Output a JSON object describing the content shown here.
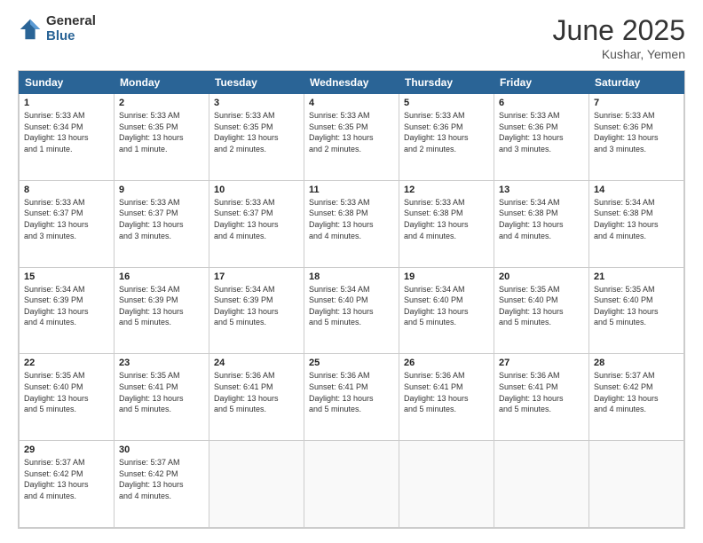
{
  "logo": {
    "general": "General",
    "blue": "Blue"
  },
  "title": "June 2025",
  "location": "Kushar, Yemen",
  "days_of_week": [
    "Sunday",
    "Monday",
    "Tuesday",
    "Wednesday",
    "Thursday",
    "Friday",
    "Saturday"
  ],
  "weeks": [
    [
      {
        "day": "1",
        "info": "Sunrise: 5:33 AM\nSunset: 6:34 PM\nDaylight: 13 hours\nand 1 minute."
      },
      {
        "day": "2",
        "info": "Sunrise: 5:33 AM\nSunset: 6:35 PM\nDaylight: 13 hours\nand 1 minute."
      },
      {
        "day": "3",
        "info": "Sunrise: 5:33 AM\nSunset: 6:35 PM\nDaylight: 13 hours\nand 2 minutes."
      },
      {
        "day": "4",
        "info": "Sunrise: 5:33 AM\nSunset: 6:35 PM\nDaylight: 13 hours\nand 2 minutes."
      },
      {
        "day": "5",
        "info": "Sunrise: 5:33 AM\nSunset: 6:36 PM\nDaylight: 13 hours\nand 2 minutes."
      },
      {
        "day": "6",
        "info": "Sunrise: 5:33 AM\nSunset: 6:36 PM\nDaylight: 13 hours\nand 3 minutes."
      },
      {
        "day": "7",
        "info": "Sunrise: 5:33 AM\nSunset: 6:36 PM\nDaylight: 13 hours\nand 3 minutes."
      }
    ],
    [
      {
        "day": "8",
        "info": "Sunrise: 5:33 AM\nSunset: 6:37 PM\nDaylight: 13 hours\nand 3 minutes."
      },
      {
        "day": "9",
        "info": "Sunrise: 5:33 AM\nSunset: 6:37 PM\nDaylight: 13 hours\nand 3 minutes."
      },
      {
        "day": "10",
        "info": "Sunrise: 5:33 AM\nSunset: 6:37 PM\nDaylight: 13 hours\nand 4 minutes."
      },
      {
        "day": "11",
        "info": "Sunrise: 5:33 AM\nSunset: 6:38 PM\nDaylight: 13 hours\nand 4 minutes."
      },
      {
        "day": "12",
        "info": "Sunrise: 5:33 AM\nSunset: 6:38 PM\nDaylight: 13 hours\nand 4 minutes."
      },
      {
        "day": "13",
        "info": "Sunrise: 5:34 AM\nSunset: 6:38 PM\nDaylight: 13 hours\nand 4 minutes."
      },
      {
        "day": "14",
        "info": "Sunrise: 5:34 AM\nSunset: 6:38 PM\nDaylight: 13 hours\nand 4 minutes."
      }
    ],
    [
      {
        "day": "15",
        "info": "Sunrise: 5:34 AM\nSunset: 6:39 PM\nDaylight: 13 hours\nand 4 minutes."
      },
      {
        "day": "16",
        "info": "Sunrise: 5:34 AM\nSunset: 6:39 PM\nDaylight: 13 hours\nand 5 minutes."
      },
      {
        "day": "17",
        "info": "Sunrise: 5:34 AM\nSunset: 6:39 PM\nDaylight: 13 hours\nand 5 minutes."
      },
      {
        "day": "18",
        "info": "Sunrise: 5:34 AM\nSunset: 6:40 PM\nDaylight: 13 hours\nand 5 minutes."
      },
      {
        "day": "19",
        "info": "Sunrise: 5:34 AM\nSunset: 6:40 PM\nDaylight: 13 hours\nand 5 minutes."
      },
      {
        "day": "20",
        "info": "Sunrise: 5:35 AM\nSunset: 6:40 PM\nDaylight: 13 hours\nand 5 minutes."
      },
      {
        "day": "21",
        "info": "Sunrise: 5:35 AM\nSunset: 6:40 PM\nDaylight: 13 hours\nand 5 minutes."
      }
    ],
    [
      {
        "day": "22",
        "info": "Sunrise: 5:35 AM\nSunset: 6:40 PM\nDaylight: 13 hours\nand 5 minutes."
      },
      {
        "day": "23",
        "info": "Sunrise: 5:35 AM\nSunset: 6:41 PM\nDaylight: 13 hours\nand 5 minutes."
      },
      {
        "day": "24",
        "info": "Sunrise: 5:36 AM\nSunset: 6:41 PM\nDaylight: 13 hours\nand 5 minutes."
      },
      {
        "day": "25",
        "info": "Sunrise: 5:36 AM\nSunset: 6:41 PM\nDaylight: 13 hours\nand 5 minutes."
      },
      {
        "day": "26",
        "info": "Sunrise: 5:36 AM\nSunset: 6:41 PM\nDaylight: 13 hours\nand 5 minutes."
      },
      {
        "day": "27",
        "info": "Sunrise: 5:36 AM\nSunset: 6:41 PM\nDaylight: 13 hours\nand 5 minutes."
      },
      {
        "day": "28",
        "info": "Sunrise: 5:37 AM\nSunset: 6:42 PM\nDaylight: 13 hours\nand 4 minutes."
      }
    ],
    [
      {
        "day": "29",
        "info": "Sunrise: 5:37 AM\nSunset: 6:42 PM\nDaylight: 13 hours\nand 4 minutes."
      },
      {
        "day": "30",
        "info": "Sunrise: 5:37 AM\nSunset: 6:42 PM\nDaylight: 13 hours\nand 4 minutes."
      },
      {
        "day": "",
        "info": ""
      },
      {
        "day": "",
        "info": ""
      },
      {
        "day": "",
        "info": ""
      },
      {
        "day": "",
        "info": ""
      },
      {
        "day": "",
        "info": ""
      }
    ]
  ]
}
